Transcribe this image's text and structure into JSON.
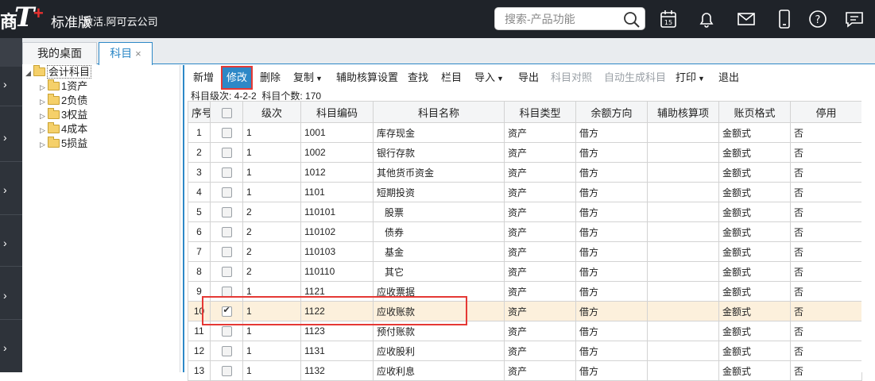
{
  "header": {
    "logo_glyph": "商",
    "logo_t": "T",
    "logo_plus": "+",
    "edition": "标准版",
    "company": "激活.阿可云公司",
    "search_placeholder": "搜索-产品功能",
    "calendar_day": "15",
    "icons": [
      "calendar-icon",
      "bell-icon",
      "mail-icon",
      "phone-icon",
      "help-icon",
      "message-icon"
    ]
  },
  "tabs": [
    {
      "label": "我的桌面",
      "active": false
    },
    {
      "label": "科目",
      "active": true,
      "close": "×"
    }
  ],
  "tree": {
    "root": "会计科目",
    "children": [
      "1资产",
      "2负债",
      "3权益",
      "4成本",
      "5损益"
    ]
  },
  "toolbar": {
    "new": "新增",
    "edit": "修改",
    "delete": "删除",
    "copy": "复制",
    "aux_setting": "辅助核算设置",
    "find": "查找",
    "columns": "栏目",
    "import": "导入",
    "export": "导出",
    "reconcile": "科目对照",
    "autogen": "自动生成科目",
    "print": "打印",
    "exit": "退出"
  },
  "info": {
    "levels": "科目级次: 4-2-2",
    "count": "科目个数: 170"
  },
  "columns": [
    "序号",
    "",
    "级次",
    "科目编码",
    "科目名称",
    "科目类型",
    "余额方向",
    "辅助核算项",
    "账页格式",
    "停用"
  ],
  "rows": [
    {
      "no": "1",
      "checked": false,
      "level": "1",
      "code": "1001",
      "name": "库存现金",
      "type": "资产",
      "dir": "借方",
      "aux": "",
      "fmt": "金额式",
      "stop": "否"
    },
    {
      "no": "2",
      "checked": false,
      "level": "1",
      "code": "1002",
      "name": "银行存款",
      "type": "资产",
      "dir": "借方",
      "aux": "",
      "fmt": "金额式",
      "stop": "否"
    },
    {
      "no": "3",
      "checked": false,
      "level": "1",
      "code": "1012",
      "name": "其他货币资金",
      "type": "资产",
      "dir": "借方",
      "aux": "",
      "fmt": "金额式",
      "stop": "否"
    },
    {
      "no": "4",
      "checked": false,
      "level": "1",
      "code": "1101",
      "name": "短期投资",
      "type": "资产",
      "dir": "借方",
      "aux": "",
      "fmt": "金额式",
      "stop": "否"
    },
    {
      "no": "5",
      "checked": false,
      "level": "2",
      "code": "110101",
      "name": "股票",
      "type": "资产",
      "dir": "借方",
      "aux": "",
      "fmt": "金额式",
      "stop": "否"
    },
    {
      "no": "6",
      "checked": false,
      "level": "2",
      "code": "110102",
      "name": "债券",
      "type": "资产",
      "dir": "借方",
      "aux": "",
      "fmt": "金额式",
      "stop": "否"
    },
    {
      "no": "7",
      "checked": false,
      "level": "2",
      "code": "110103",
      "name": "基金",
      "type": "资产",
      "dir": "借方",
      "aux": "",
      "fmt": "金额式",
      "stop": "否"
    },
    {
      "no": "8",
      "checked": false,
      "level": "2",
      "code": "110110",
      "name": "其它",
      "type": "资产",
      "dir": "借方",
      "aux": "",
      "fmt": "金额式",
      "stop": "否"
    },
    {
      "no": "9",
      "checked": false,
      "level": "1",
      "code": "1121",
      "name": "应收票据",
      "type": "资产",
      "dir": "借方",
      "aux": "",
      "fmt": "金额式",
      "stop": "否"
    },
    {
      "no": "10",
      "checked": true,
      "level": "1",
      "code": "1122",
      "name": "应收账款",
      "type": "资产",
      "dir": "借方",
      "aux": "",
      "fmt": "金额式",
      "stop": "否",
      "selected": true
    },
    {
      "no": "11",
      "checked": false,
      "level": "1",
      "code": "1123",
      "name": "预付账款",
      "type": "资产",
      "dir": "借方",
      "aux": "",
      "fmt": "金额式",
      "stop": "否"
    },
    {
      "no": "12",
      "checked": false,
      "level": "1",
      "code": "1131",
      "name": "应收股利",
      "type": "资产",
      "dir": "借方",
      "aux": "",
      "fmt": "金额式",
      "stop": "否"
    },
    {
      "no": "13",
      "checked": false,
      "level": "1",
      "code": "1132",
      "name": "应收利息",
      "type": "资产",
      "dir": "借方",
      "aux": "",
      "fmt": "金额式",
      "stop": "否"
    }
  ]
}
